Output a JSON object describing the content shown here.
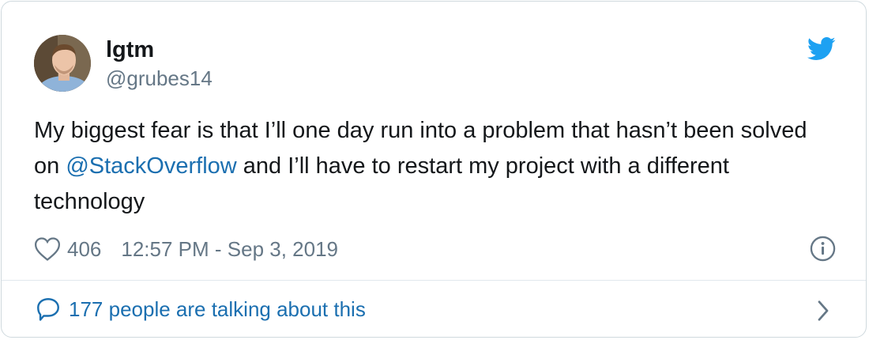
{
  "tweet": {
    "display_name": "lgtm",
    "handle": "@grubes14",
    "text_before": "My biggest fear is that I’ll one day run into a problem that hasn’t been solved on ",
    "mention": "@StackOverflow",
    "text_after": " and I’ll have to restart my project with a different technology",
    "like_count": "406",
    "timestamp": "12:57 PM - Sep 3, 2019",
    "talking_label": "177 people are talking about this"
  },
  "icons": {
    "brand": "twitter-bird-icon",
    "like": "heart-icon",
    "info": "info-icon",
    "reply": "speech-bubble-icon",
    "more": "chevron-right-icon"
  },
  "colors": {
    "text": "#14171a",
    "secondary": "#657786",
    "link": "#1b6fb0",
    "brand": "#1da1f2",
    "border": "#cfd9de"
  }
}
